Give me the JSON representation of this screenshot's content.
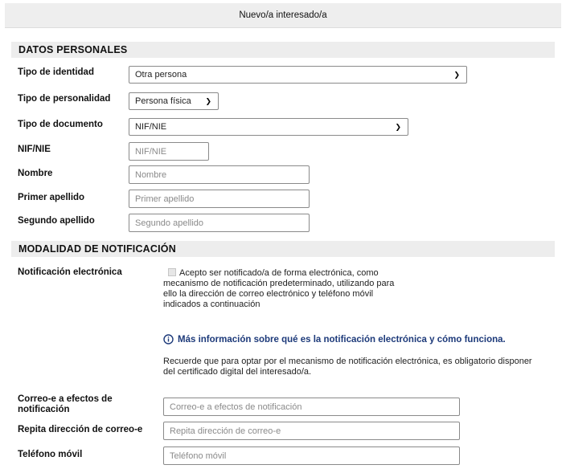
{
  "dialog": {
    "title": "Nuevo/a interesado/a"
  },
  "personal": {
    "section_title": "DATOS PERSONALES",
    "tipo_identidad": {
      "label": "Tipo de identidad",
      "value": "Otra persona"
    },
    "tipo_personalidad": {
      "label": "Tipo de personalidad",
      "value": "Persona física"
    },
    "tipo_documento": {
      "label": "Tipo de documento",
      "value": "NIF/NIE"
    },
    "nif": {
      "label": "NIF/NIE",
      "placeholder": "NIF/NIE"
    },
    "nombre": {
      "label": "Nombre",
      "placeholder": "Nombre"
    },
    "primer_apellido": {
      "label": "Primer apellido",
      "placeholder": "Primer apellido"
    },
    "segundo_apellido": {
      "label": "Segundo apellido",
      "placeholder": "Segundo apellido"
    }
  },
  "notification": {
    "section_title": "MODALIDAD DE NOTIFICACIÓN",
    "electronic_label": "Notificación electrónica",
    "consent_text": "Acepto ser notificado/a de forma electrónica, como mecanismo de notificación predeterminado, utilizando para ello la dirección de correo electrónico y teléfono móvil indicados a continuación",
    "consent_checked": false,
    "info_link": "Más información sobre qué es la notificación electrónica y cómo funciona.",
    "note": "Recuerde que para optar por el mecanismo de notificación electrónica, es obligatorio disponer del certificado digital del interesado/a.",
    "email": {
      "label": "Correo-e a efectos de notificación",
      "placeholder": "Correo-e a efectos de notificación"
    },
    "email_repeat": {
      "label": "Repita dirección de correo-e",
      "placeholder": "Repita dirección de correo-e"
    },
    "phone": {
      "label": "Teléfono móvil",
      "placeholder": "Teléfono móvil"
    }
  },
  "icons": {
    "select_arrow": "chevron-down-icon",
    "info": "info-link-icon"
  },
  "colors": {
    "section_bg": "#ededed",
    "link": "#1d3a7a",
    "field_border": "#8a8a8a"
  }
}
